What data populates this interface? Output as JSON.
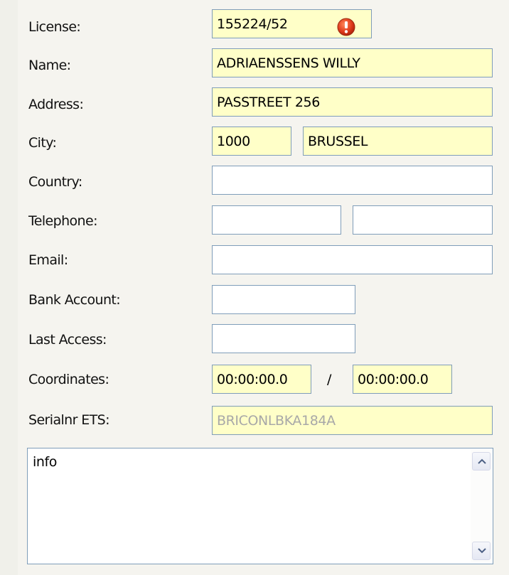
{
  "labels": {
    "license": "License:",
    "name": "Name:",
    "address": "Address:",
    "city": "City:",
    "country": "Country:",
    "telephone": "Telephone:",
    "email": "Email:",
    "bank_account": "Bank Account:",
    "last_access": "Last Access:",
    "coordinates": "Coordinates:",
    "serialnr": "Serialnr ETS:"
  },
  "values": {
    "license": "155224/52",
    "name": "ADRIAENSSENS WILLY",
    "address": "PASSTREET 256",
    "postal_code": "1000",
    "city": "BRUSSEL",
    "country": "",
    "telephone_1": "",
    "telephone_2": "",
    "email": "",
    "bank_account": "",
    "last_access": "",
    "coordinate_1": "00:00:00.0",
    "coordinate_2": "00:00:00.0",
    "serialnr": "BRICONLBKA184A",
    "info": "info"
  },
  "coordinates_separator": "/",
  "icons": {
    "license_status": "error-icon",
    "scroll_up": "chevron-up-icon",
    "scroll_down": "chevron-down-icon"
  },
  "colors": {
    "filled_field": "#ffffc8",
    "field_border": "#7f9db9",
    "error": "#e03c1c",
    "disabled_text": "#a8a8a8"
  }
}
